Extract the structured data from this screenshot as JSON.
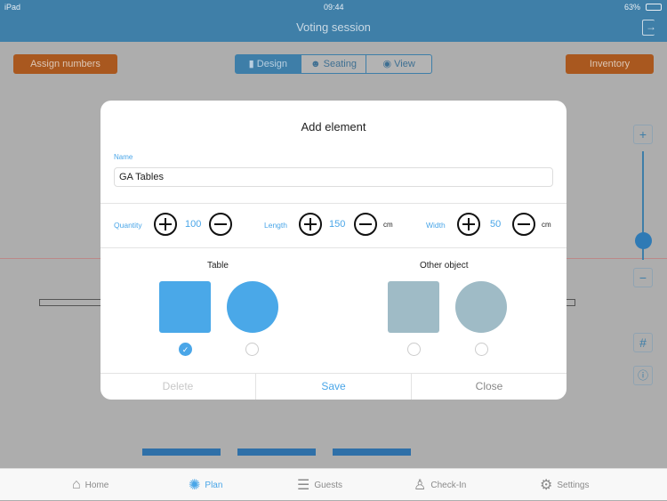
{
  "status_bar": {
    "device": "iPad",
    "time": "09:44",
    "battery": "63%"
  },
  "navbar": {
    "title": "Voting session",
    "exit_icon": "logout-icon"
  },
  "toolbar": {
    "assign_numbers": "Assign numbers",
    "inventory": "Inventory",
    "modes": [
      {
        "label": "Design",
        "icon": "chair-icon",
        "selected": true
      },
      {
        "label": "Seating",
        "icon": "people-icon",
        "selected": false
      },
      {
        "label": "View",
        "icon": "eye-icon",
        "selected": false
      }
    ]
  },
  "zoom_slider": {
    "level": 0.18
  },
  "modal": {
    "title": "Add element",
    "name_label": "Name",
    "name_value": "GA Tables",
    "quantity": {
      "label": "Quantity",
      "value": "100"
    },
    "length": {
      "label": "Length",
      "value": "150",
      "unit": "cm"
    },
    "width": {
      "label": "Width",
      "value": "50",
      "unit": "cm"
    },
    "table_section": "Table",
    "other_section": "Other object",
    "options": [
      {
        "type": "table-square",
        "selected": true
      },
      {
        "type": "table-round",
        "selected": false
      },
      {
        "type": "object-square",
        "selected": false
      },
      {
        "type": "object-round",
        "selected": false
      }
    ],
    "delete": "Delete",
    "save": "Save",
    "close": "Close",
    "colors": {
      "table": "#4aa8e8",
      "other": "#9fbbc6",
      "accent": "#4aa6e8"
    }
  },
  "tabbar": [
    {
      "label": "Home",
      "icon": "home-icon"
    },
    {
      "label": "Plan",
      "icon": "plan-icon",
      "active": true
    },
    {
      "label": "Guests",
      "icon": "clipboard-icon"
    },
    {
      "label": "Check-In",
      "icon": "person-check-icon"
    },
    {
      "label": "Settings",
      "icon": "gear-icon"
    }
  ]
}
